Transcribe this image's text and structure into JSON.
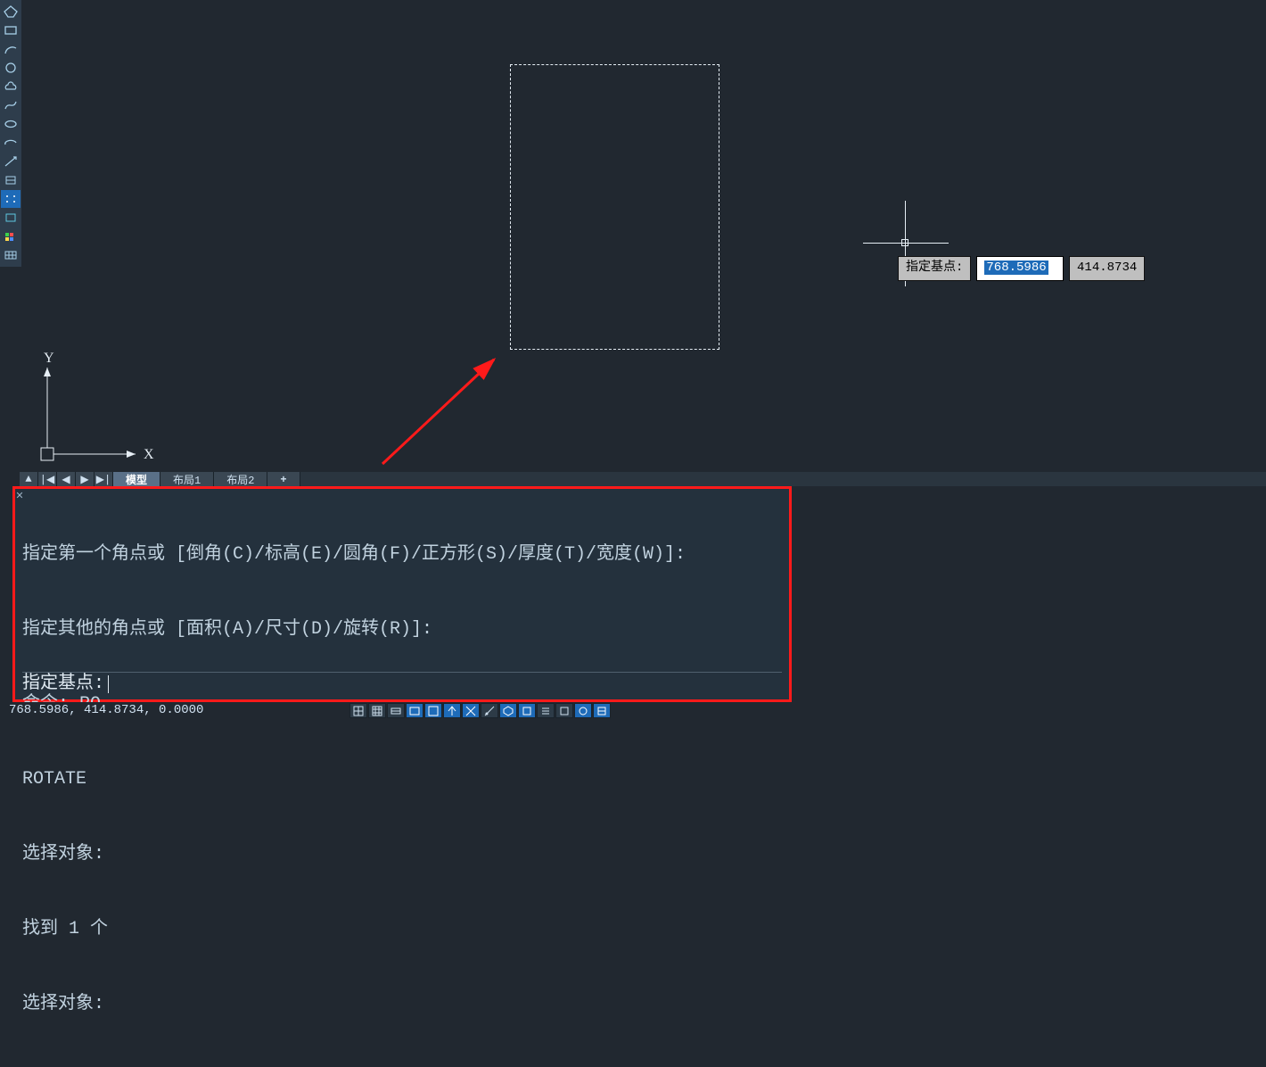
{
  "toolbar": {
    "tools": [
      "polygon-tool",
      "rectangle-tool",
      "arc-tool",
      "circle-tool",
      "cloud-tool",
      "spline-tool",
      "ellipse-tool",
      "ellipse-arc-tool",
      "ray-tool",
      "helix-tool",
      "point-mode-tool",
      "rect-fill-tool",
      "color-blocks-tool",
      "table-tool"
    ]
  },
  "canvas": {
    "ucs": {
      "x_label": "X",
      "y_label": "Y"
    },
    "dynamic_input": {
      "prompt": "指定基点:",
      "x": "768.5986",
      "y": "414.8734"
    }
  },
  "tabs": {
    "nav": [
      "▲",
      "|◀",
      "◀",
      "▶",
      "▶|"
    ],
    "items": [
      {
        "label": "模型",
        "active": true
      },
      {
        "label": "布局1",
        "active": false
      },
      {
        "label": "布局2",
        "active": false
      }
    ],
    "add": "+"
  },
  "command": {
    "history": [
      "指定第一个角点或 [倒角(C)/标高(E)/圆角(F)/正方形(S)/厚度(T)/宽度(W)]:",
      "指定其他的角点或 [面积(A)/尺寸(D)/旋转(R)]:",
      "命令: RO",
      "ROTATE",
      "选择对象:",
      "找到 1 个",
      "选择对象:"
    ],
    "prompt": "指定基点: "
  },
  "status": {
    "coords": "768.5986, 414.8734, 0.0000",
    "buttons": [
      {
        "name": "grid-display",
        "on": false
      },
      {
        "name": "snap-mode",
        "on": false
      },
      {
        "name": "infer-constraints",
        "on": false
      },
      {
        "name": "dynamic-input",
        "on": true
      },
      {
        "name": "ortho-mode",
        "on": true
      },
      {
        "name": "polar-tracking",
        "on": true
      },
      {
        "name": "isometric-drafting",
        "on": true
      },
      {
        "name": "object-snap-tracking",
        "on": false
      },
      {
        "name": "3d-osnap",
        "on": true
      },
      {
        "name": "object-snap",
        "on": true
      },
      {
        "name": "lineweight",
        "on": false
      },
      {
        "name": "transparency",
        "on": false
      },
      {
        "name": "selection-cycling",
        "on": true
      },
      {
        "name": "annotation-monitor",
        "on": true
      }
    ]
  }
}
